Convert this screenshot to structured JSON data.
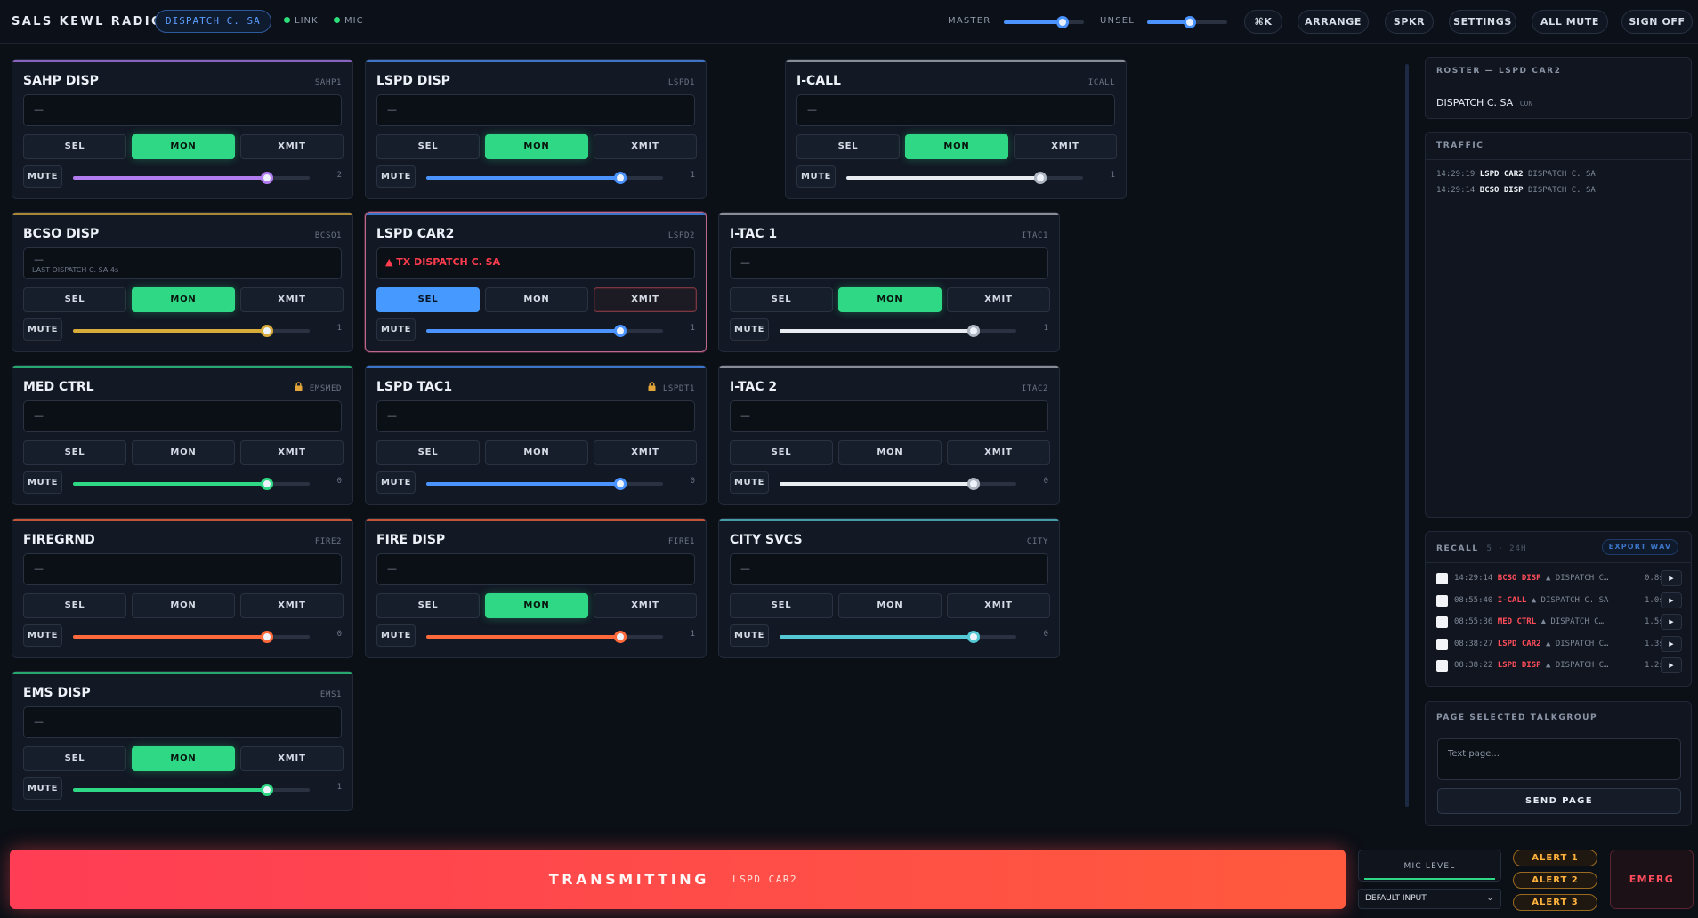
{
  "app": {
    "title": "SALS KEWL RADIO",
    "identity": "DISPATCH C. SA"
  },
  "indicators": {
    "link": "LINK",
    "mic": "MIC"
  },
  "volume": {
    "master_label": "MASTER",
    "master_level": 0.73,
    "unsel_label": "UNSEL",
    "unsel_level": 0.53
  },
  "toolbar": {
    "shortcut": "⌘K",
    "arrange": "ARRANGE",
    "spkr": "SPKR",
    "settings": "SETTINGS",
    "all_mute": "ALL MUTE",
    "sign_off": "SIGN OFF"
  },
  "labels": {
    "sel": "SEL",
    "mon": "MON",
    "xmit": "XMIT",
    "mute": "MUTE",
    "empty": "—"
  },
  "colors": {
    "sahp": "#b07cf0",
    "blue": "#4b93ff",
    "white": "#e9edf2",
    "bcso": "#d8ac3a",
    "green": "#2fd884",
    "orange": "#ff6a3d",
    "teal": "#54c8d4",
    "tx_red": "#ff3d55"
  },
  "talkgroups": [
    {
      "name": "SAHP DISP",
      "code": "SAHP1",
      "mon": true,
      "sel": false,
      "tx": false,
      "locked": false,
      "level": 0.82,
      "count": "2",
      "color": "#b07cf0",
      "display_sub": "",
      "tx_text": ""
    },
    {
      "name": "LSPD DISP",
      "code": "LSPD1",
      "mon": true,
      "sel": false,
      "tx": false,
      "locked": false,
      "level": 0.82,
      "count": "1",
      "color": "#4b93ff",
      "display_sub": "",
      "tx_text": ""
    },
    {
      "name": "I-CALL",
      "code": "ICALL",
      "mon": true,
      "sel": false,
      "tx": false,
      "locked": false,
      "level": 0.82,
      "count": "1",
      "color": "#e9edf2",
      "display_sub": "",
      "tx_text": ""
    },
    {
      "name": "BCSO DISP",
      "code": "BCSO1",
      "mon": true,
      "sel": false,
      "tx": false,
      "locked": false,
      "level": 0.82,
      "count": "1",
      "color": "#d8ac3a",
      "display_sub": "LAST DISPATCH C. SA 4s",
      "tx_text": ""
    },
    {
      "name": "LSPD CAR2",
      "code": "LSPD2",
      "mon": false,
      "sel": true,
      "tx": true,
      "locked": false,
      "level": 0.82,
      "count": "1",
      "color": "#4b93ff",
      "display_sub": "",
      "tx_text": "▲ TX DISPATCH C. SA"
    },
    {
      "name": "I-TAC 1",
      "code": "ITAC1",
      "mon": true,
      "sel": false,
      "tx": false,
      "locked": false,
      "level": 0.82,
      "count": "1",
      "color": "#e9edf2",
      "display_sub": "",
      "tx_text": ""
    },
    {
      "name": "MED CTRL",
      "code": "EMSMED",
      "mon": false,
      "sel": false,
      "tx": false,
      "locked": true,
      "level": 0.82,
      "count": "0",
      "color": "#2fd884",
      "display_sub": "",
      "tx_text": ""
    },
    {
      "name": "LSPD TAC1",
      "code": "LSPDT1",
      "mon": false,
      "sel": false,
      "tx": false,
      "locked": true,
      "level": 0.82,
      "count": "0",
      "color": "#4b93ff",
      "display_sub": "",
      "tx_text": ""
    },
    {
      "name": "I-TAC 2",
      "code": "ITAC2",
      "mon": false,
      "sel": false,
      "tx": false,
      "locked": false,
      "level": 0.82,
      "count": "0",
      "color": "#e9edf2",
      "display_sub": "",
      "tx_text": ""
    },
    {
      "name": "FIREGRND",
      "code": "FIRE2",
      "mon": false,
      "sel": false,
      "tx": false,
      "locked": false,
      "level": 0.82,
      "count": "0",
      "color": "#ff6a3d",
      "display_sub": "",
      "tx_text": ""
    },
    {
      "name": "FIRE DISP",
      "code": "FIRE1",
      "mon": true,
      "sel": false,
      "tx": false,
      "locked": false,
      "level": 0.82,
      "count": "1",
      "color": "#ff6a3d",
      "display_sub": "",
      "tx_text": ""
    },
    {
      "name": "CITY SVCS",
      "code": "CITY",
      "mon": false,
      "sel": false,
      "tx": false,
      "locked": false,
      "level": 0.82,
      "count": "0",
      "color": "#54c8d4",
      "display_sub": "",
      "tx_text": ""
    },
    {
      "name": "EMS DISP",
      "code": "EMS1",
      "mon": true,
      "sel": false,
      "tx": false,
      "locked": false,
      "level": 0.82,
      "count": "1",
      "color": "#2fd884",
      "display_sub": "",
      "tx_text": ""
    }
  ],
  "roster": {
    "title": "ROSTER — LSPD CAR2",
    "entries": [
      {
        "name": "DISPATCH C. SA",
        "tag": "CON"
      }
    ]
  },
  "traffic": {
    "title": "TRAFFIC",
    "rows": [
      {
        "time": "14:29:19",
        "tg": "LSPD CAR2",
        "who": "DISPATCH C. SA"
      },
      {
        "time": "14:29:14",
        "tg": "BCSO DISP",
        "who": "DISPATCH C. SA"
      }
    ]
  },
  "recall": {
    "title": "RECALL",
    "meta": "5 · 24H",
    "export": "EXPORT WAV",
    "rows": [
      {
        "time": "14:29:14",
        "tg": "BCSO DISP",
        "who": "▲ DISPATCH C…",
        "dur": "0.8s"
      },
      {
        "time": "08:55:40",
        "tg": "I-CALL",
        "who": "▲ DISPATCH C. SA",
        "dur": "1.0s"
      },
      {
        "time": "08:55:36",
        "tg": "MED CTRL",
        "who": "▲ DISPATCH C…",
        "dur": "1.5s"
      },
      {
        "time": "08:38:27",
        "tg": "LSPD CAR2",
        "who": "▲ DISPATCH C…",
        "dur": "1.3s"
      },
      {
        "time": "08:38:22",
        "tg": "LSPD DISP",
        "who": "▲ DISPATCH C…",
        "dur": "1.2s"
      }
    ]
  },
  "page": {
    "title": "PAGE SELECTED TALKGROUP",
    "placeholder": "Text page...",
    "send": "SEND PAGE"
  },
  "bottom": {
    "tx_label": "TRANSMITTING",
    "tx_target": "LSPD CAR2",
    "mic_level": "MIC LEVEL",
    "input": "DEFAULT INPUT",
    "alerts": [
      "ALERT 1",
      "ALERT 2",
      "ALERT 3"
    ],
    "emerg": "EMERG"
  }
}
